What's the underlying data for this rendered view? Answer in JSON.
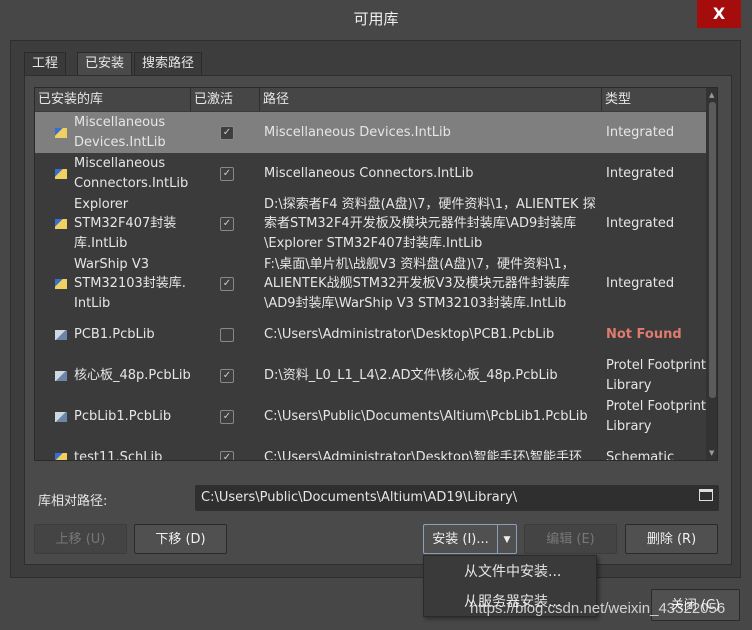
{
  "window": {
    "title": "可用库",
    "close_label": "X"
  },
  "tabs": [
    {
      "label": "工程"
    },
    {
      "label": "已安装",
      "active": true
    },
    {
      "label": "搜索路径"
    }
  ],
  "table": {
    "columns": [
      "已安装的库",
      "已激活",
      "路径",
      "类型"
    ],
    "rows": [
      {
        "name": [
          "Miscellaneous",
          "Devices.IntLib"
        ],
        "active": true,
        "path": [
          "Miscellaneous Devices.IntLib"
        ],
        "type": [
          "Integrated"
        ],
        "selected": true,
        "icon": "intlib-icon"
      },
      {
        "name": [
          "Miscellaneous",
          "Connectors.IntLib"
        ],
        "active": true,
        "path": [
          "Miscellaneous Connectors.IntLib"
        ],
        "type": [
          "Integrated"
        ],
        "icon": "intlib-icon"
      },
      {
        "name": [
          "Explorer",
          "STM32F407封装",
          "库.IntLib"
        ],
        "active": true,
        "path": [
          "D:\\探索者F4 资料盘(A盘)\\7，硬件资料\\1，ALIENTEK 探",
          "索者STM32F4开发板及模块元器件封装库\\AD9封装库",
          "\\Explorer STM32F407封装库.IntLib"
        ],
        "type": [
          "Integrated"
        ],
        "icon": "intlib-icon"
      },
      {
        "name": [
          "WarShip V3",
          "STM32103封装库.",
          "IntLib"
        ],
        "active": true,
        "path": [
          "F:\\桌面\\单片机\\战舰V3 资料盘(A盘)\\7，硬件资料\\1，",
          "ALIENTEK战舰STM32开发板V3及模块元器件封装库",
          "\\AD9封装库\\WarShip V3 STM32103封装库.IntLib"
        ],
        "type": [
          "Integrated"
        ],
        "icon": "intlib-icon"
      },
      {
        "name": [
          "PCB1.PcbLib"
        ],
        "active": false,
        "path": [
          "C:\\Users\\Administrator\\Desktop\\PCB1.PcbLib"
        ],
        "type": [
          "Not Found"
        ],
        "type_status": "error",
        "icon": "pcblib-icon"
      },
      {
        "name": [
          "核心板_48p.PcbLib"
        ],
        "active": true,
        "path": [
          "D:\\资料_L0_L1_L4\\2.AD文件\\核心板_48p.PcbLib"
        ],
        "type": [
          "Protel Footprint",
          "Library"
        ],
        "icon": "pcblib-icon"
      },
      {
        "name": [
          "PcbLib1.PcbLib"
        ],
        "active": true,
        "path": [
          "C:\\Users\\Public\\Documents\\Altium\\PcbLib1.PcbLib"
        ],
        "type": [
          "Protel Footprint",
          "Library"
        ],
        "icon": "pcblib-icon"
      },
      {
        "name": [
          "test11.SchLib"
        ],
        "active": true,
        "path": [
          "C:\\Users\\Administrator\\Desktop\\智能手环\\智能手环"
        ],
        "type": [
          "Schematic"
        ],
        "icon": "schlib-icon"
      }
    ]
  },
  "relative_path": {
    "label": "库相对路径:",
    "value": "C:\\Users\\Public\\Documents\\Altium\\AD19\\Library\\"
  },
  "buttons": {
    "up": "上移 (U)",
    "down": "下移 (D)",
    "install": "安装 (I)...",
    "edit": "编辑 (E)",
    "delete": "删除 (R)",
    "close": "关闭 (C)"
  },
  "install_menu": [
    "从文件中安装...",
    "从服务器安装..."
  ],
  "watermark": "https://blog.csdn.net/weixin_43322056",
  "colors": {
    "error": "#e07a6e",
    "selected_row": "#7f7f7f",
    "close_button": "#a50d0d"
  }
}
